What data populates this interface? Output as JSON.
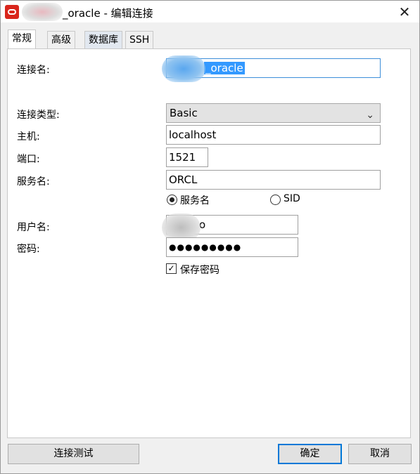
{
  "window": {
    "title_suffix": "_oracle - 编辑连接",
    "close_glyph": "✕",
    "accent_color": "#0078d7",
    "icon_color": "#d9261c"
  },
  "tabs": [
    {
      "label": "常规",
      "active": true
    },
    {
      "label": "高级",
      "active": false
    },
    {
      "label": "数据库",
      "active": false
    },
    {
      "label": "SSH",
      "active": false
    }
  ],
  "form": {
    "connection_name": {
      "label": "连接名:",
      "value_suffix": "_oracle"
    },
    "connection_type": {
      "label": "连接类型:",
      "value": "Basic"
    },
    "host": {
      "label": "主机:",
      "value": "localhost"
    },
    "port": {
      "label": "端口:",
      "value": "1521"
    },
    "service_name": {
      "label": "服务名:",
      "value": "ORCL"
    },
    "mode_radios": [
      {
        "label": "服务名",
        "selected": true
      },
      {
        "label": "SID",
        "selected": false
      }
    ],
    "username": {
      "label": "用户名:",
      "value_suffix": "o"
    },
    "password": {
      "label": "密码:",
      "masked_value": "●●●●●●●●●"
    },
    "save_password": {
      "label": "保存密码",
      "checked": true
    }
  },
  "buttons": {
    "test": "连接测试",
    "ok": "确定",
    "cancel": "取消"
  }
}
